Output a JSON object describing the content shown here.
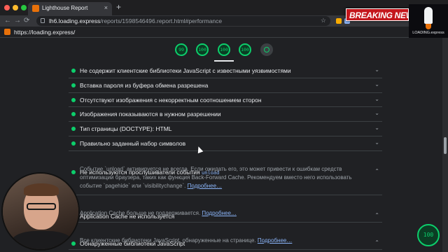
{
  "browser": {
    "tab_title": "Lighthouse Report",
    "tab_close": "×",
    "new_tab": "+",
    "url_host": "lh6.loading.express",
    "url_path": "/reports/1598546496.report.html#performance",
    "nav_back": "←",
    "nav_forward": "→",
    "nav_reload": "⟳",
    "star": "☆",
    "traffic_colors": [
      "#ff5f57",
      "#febc2e",
      "#28c840"
    ]
  },
  "page_header": {
    "url": "https://loading.express/"
  },
  "overlay": {
    "news_label": "BREAKING NEWS",
    "logo_text": "LOADING.express"
  },
  "scores": [
    {
      "label": "99",
      "name": "performance"
    },
    {
      "label": "100",
      "name": "accessibility"
    },
    {
      "label": "100",
      "name": "best-practices"
    },
    {
      "label": "100",
      "name": "seo"
    }
  ],
  "audits": [
    {
      "title": "Не содержит клиентские библиотеки JavaScript с известными уязвимостями",
      "chevron": "⌄"
    },
    {
      "title": "Вставка пароля из буфера обмена разрешена",
      "chevron": "⌄"
    },
    {
      "title": "Отсутствуют изображения с некорректным соотношением сторон",
      "chevron": "⌄"
    },
    {
      "title": "Изображения показываются в нужном разрешении",
      "chevron": "⌄"
    },
    {
      "title": "Тип страницы (DOCTYPE): HTML",
      "chevron": "⌄"
    },
    {
      "title": "Правильно заданный набор символов",
      "chevron": "⌄"
    }
  ],
  "expanded_audits": [
    {
      "title": "Не используются прослушиватели события",
      "code": "unload",
      "chevron": "⌃",
      "description": "Событие `unload` активируется не всегда. Если ожидать его, это может привести к ошибкам средств оптимизации браузера, таких как функция Back-Forward Cache. Рекомендуем вместо него использовать событие `pagehide` или `visibilitychange`.",
      "link": "Подробнее…"
    },
    {
      "title": "Application Cache не используется",
      "code": "",
      "chevron": "⌃",
      "description": "Application Cache больше не поддерживается.",
      "link": "Подробнее…"
    },
    {
      "title": "Обнаруженные библиотеки JavaScript",
      "code": "",
      "chevron": "⌃",
      "description": "Все клиентские библиотеки JavaScript, обнаруженные на странице.",
      "link": "Подробнее…"
    }
  ],
  "lighthouse_badge": "100",
  "colors": {
    "pass": "#0cce6b",
    "link": "#8ab4f8",
    "news_red": "#c4161c"
  }
}
